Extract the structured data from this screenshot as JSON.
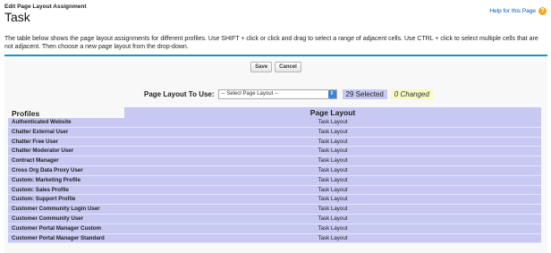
{
  "header": {
    "breadcrumb": "Edit Page Layout Assignment",
    "title": "Task",
    "help_label": "Help for this Page",
    "help_icon": "question-icon"
  },
  "description": "The table below shows the page layout assignments for different profiles. Use SHIFT + click or click and drag to select a range of adjacent cells. Use CTRL + click to select multiple cells that are not adjacent. Then choose a new page layout from the drop-down.",
  "toolbar": {
    "save_label": "Save",
    "cancel_label": "Cancel"
  },
  "layout_picker": {
    "label": "Page Layout To Use:",
    "selected_value": "-- Select Page Layout --",
    "selected_count": "29 Selected",
    "changed_count": "0 Changed"
  },
  "table": {
    "headers": {
      "profiles": "Profiles",
      "page_layout": "Page Layout"
    },
    "rows": [
      {
        "profile": "Authenticated Website",
        "layout": "Task Layout"
      },
      {
        "profile": "Chatter External User",
        "layout": "Task Layout"
      },
      {
        "profile": "Chatter Free User",
        "layout": "Task Layout"
      },
      {
        "profile": "Chatter Moderator User",
        "layout": "Task Layout"
      },
      {
        "profile": "Contract Manager",
        "layout": "Task Layout"
      },
      {
        "profile": "Cross Org Data Proxy User",
        "layout": "Task Layout"
      },
      {
        "profile": "Custom: Marketing Profile",
        "layout": "Task Layout"
      },
      {
        "profile": "Custom: Sales Profile",
        "layout": "Task Layout"
      },
      {
        "profile": "Custom: Support Profile",
        "layout": "Task Layout"
      },
      {
        "profile": "Customer Community Login User",
        "layout": "Task Layout"
      },
      {
        "profile": "Customer Community User",
        "layout": "Task Layout"
      },
      {
        "profile": "Customer Portal Manager Custom",
        "layout": "Task Layout"
      },
      {
        "profile": "Customer Portal Manager Standard",
        "layout": "Task Layout"
      }
    ]
  },
  "colors": {
    "accent_border": "#1797c0",
    "selected_cell": "#c7c9f3",
    "changed_badge": "#f9f9c2",
    "help_icon": "#f5a623"
  }
}
